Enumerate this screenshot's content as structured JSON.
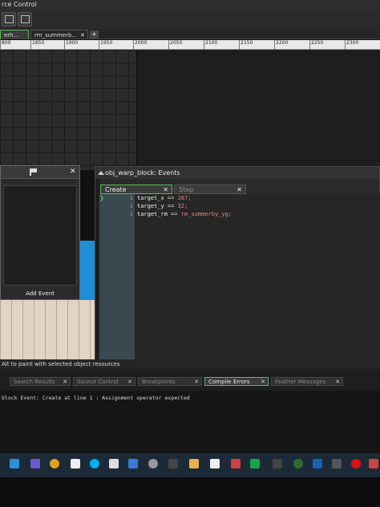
{
  "menu": {
    "title": "rce Control"
  },
  "tabs": [
    {
      "label": "erh...",
      "active": true
    },
    {
      "label": "rm_summerb...",
      "active": false
    }
  ],
  "add_tab_label": "+",
  "ruler_labels": [
    "800",
    "1850",
    "1900",
    "1950",
    "2000",
    "2050",
    "2100",
    "2150",
    "2200",
    "2250",
    "2300"
  ],
  "left_panel": {
    "add_event_label": "Add Event"
  },
  "events_window": {
    "title": "obj_warp_block: Events",
    "tabs": [
      {
        "label": "Create",
        "active": true
      },
      {
        "label": "Step",
        "active": false
      }
    ],
    "code": [
      {
        "num": "1",
        "var": "target_x",
        "op": " == ",
        "val": "287;"
      },
      {
        "num": "2",
        "var": "target_y",
        "op": " == ",
        "val": "32;"
      },
      {
        "num": "3",
        "var": "target_rm",
        "op": " == ",
        "val": "rm_summerby_yg;"
      }
    ]
  },
  "status_text": "Alt to paint with selected object resources",
  "bottom_tabs": [
    {
      "label": "Search Results",
      "active": false
    },
    {
      "label": "Source Control",
      "active": false
    },
    {
      "label": "Breakpoints",
      "active": false
    },
    {
      "label": "Compile Errors",
      "active": true
    },
    {
      "label": "Feather Messages",
      "active": false
    }
  ],
  "output_text": "block Event: Create at line 1 : Assignment operator expected",
  "colors": {
    "accent_green": "#5cb85c",
    "number_red": "#f08080",
    "taskbar": "#1c2a38"
  },
  "taskbar_icons": [
    "edge-icon",
    "teams-icon",
    "chrome-icon",
    "file-icon",
    "skype-icon",
    "camera-icon",
    "gamemaker-icon",
    "cd-icon",
    "store-icon",
    "folder-icon",
    "gmail-icon",
    "calc-icon",
    "xbox-icon",
    "game-icon",
    "steam-icon",
    "onedrive-icon",
    "music-icon",
    "opera-icon",
    "paint-icon"
  ]
}
